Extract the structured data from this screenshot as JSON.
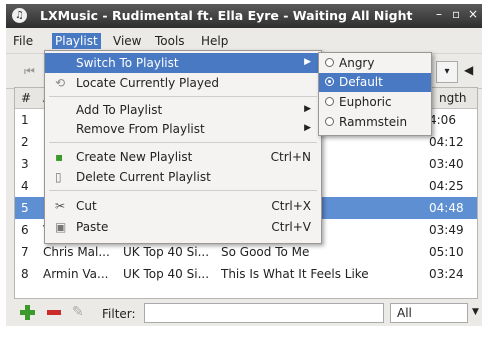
{
  "window": {
    "title": "LXMusic - Rudimental ft. Ella Eyre - Waiting All Night",
    "controls": [
      "–",
      "▫",
      "×"
    ]
  },
  "menubar": [
    "File",
    "Playlist",
    "View",
    "Tools",
    "Help"
  ],
  "toolbar": {
    "prev_icon": "prev-icon",
    "combo_arrow": "▾",
    "volume_icon": "volume-icon"
  },
  "table": {
    "headers": [
      "#",
      "A",
      "ngth"
    ],
    "rows": [
      {
        "num": "1",
        "artist": "D",
        "album": "",
        "title": "",
        "length": "4:06"
      },
      {
        "num": "2",
        "artist": "F",
        "album": "",
        "title": "",
        "length": "04:12"
      },
      {
        "num": "3",
        "artist": "D",
        "album": "",
        "title": "",
        "length": "03:40"
      },
      {
        "num": "4",
        "artist": "N",
        "album": "",
        "title": "",
        "length": "04:25"
      },
      {
        "num": "5",
        "artist": "F",
        "album": "",
        "title": "ght",
        "length": "04:48"
      },
      {
        "num": "6",
        "artist": "V",
        "album": "",
        "title": "",
        "length": "03:49"
      },
      {
        "num": "7",
        "artist": "Chris Mal...",
        "album": "UK Top 40 Si...",
        "title": "So Good To Me",
        "length": "05:10"
      },
      {
        "num": "8",
        "artist": "Armin Va...",
        "album": "UK Top 40 Si...",
        "title": "This Is What It Feels Like",
        "length": "03:24"
      }
    ]
  },
  "menu": {
    "switch": "Switch To Playlist",
    "locate": "Locate Currently Played",
    "add_to": "Add To Playlist",
    "remove_from": "Remove From Playlist",
    "create": "Create New Playlist",
    "create_sc": "Ctrl+N",
    "delete": "Delete Current Playlist",
    "cut": "Cut",
    "cut_sc": "Ctrl+X",
    "paste": "Paste",
    "paste_sc": "Ctrl+V"
  },
  "submenu": {
    "items": [
      "Angry",
      "Default",
      "Euphoric",
      "Rammstein"
    ],
    "selected": "Default"
  },
  "bottombar": {
    "filter_label": "Filter:",
    "filter_value": "",
    "filter_option": "All"
  },
  "colors": {
    "highlight": "#4a79c4",
    "selected_row": "#5f8fd3",
    "add": "#3c9a2c",
    "remove": "#cc2b2b"
  }
}
